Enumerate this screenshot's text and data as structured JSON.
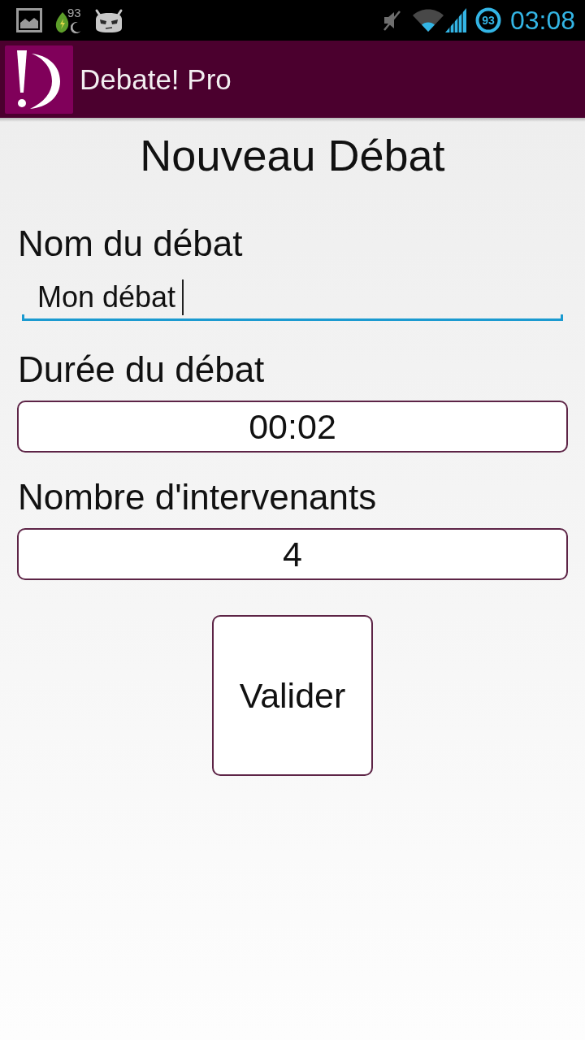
{
  "status_bar": {
    "notification_count": "93",
    "battery_percent": "93",
    "time": "03:08"
  },
  "app_bar": {
    "title": "Debate! Pro"
  },
  "heading": "Nouveau Débat",
  "form": {
    "fields": [
      {
        "kind": "text",
        "label": "Nom du débat",
        "value": "Mon débat",
        "focused": true
      },
      {
        "kind": "box",
        "label": "Durée du débat",
        "value": "00:02",
        "focused": false
      },
      {
        "kind": "box",
        "label": "Nombre d'intervenants",
        "value": "4",
        "focused": false
      }
    ]
  },
  "submit_button": "Valider"
}
